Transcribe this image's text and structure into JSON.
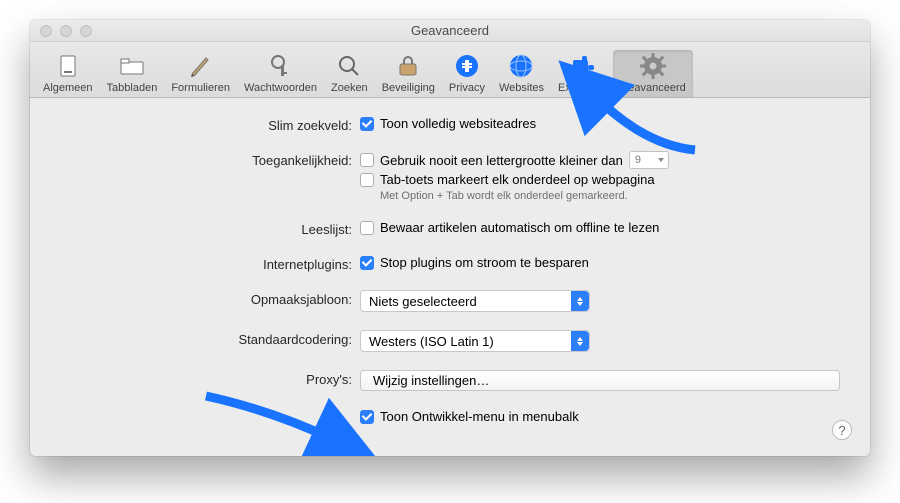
{
  "window": {
    "title": "Geavanceerd"
  },
  "toolbar": {
    "items": [
      {
        "id": "algemeen",
        "label": "Algemeen"
      },
      {
        "id": "tabbladen",
        "label": "Tabbladen"
      },
      {
        "id": "formulieren",
        "label": "Formulieren"
      },
      {
        "id": "wachtwoorden",
        "label": "Wachtwoorden"
      },
      {
        "id": "zoeken",
        "label": "Zoeken"
      },
      {
        "id": "beveiliging",
        "label": "Beveiliging"
      },
      {
        "id": "privacy",
        "label": "Privacy"
      },
      {
        "id": "websites",
        "label": "Websites"
      },
      {
        "id": "extensies",
        "label": "Extensies"
      },
      {
        "id": "geavanceerd",
        "label": "Geavanceerd"
      }
    ],
    "active": "geavanceerd"
  },
  "labels": {
    "smart_search": "Slim zoekveld:",
    "accessibility": "Toegankelijkheid:",
    "reading_list": "Leeslijst:",
    "internet_plugins": "Internetplugins:",
    "stylesheet": "Opmaaksjabloon:",
    "encoding": "Standaardcodering:",
    "proxies": "Proxy's:"
  },
  "fields": {
    "show_full_address": {
      "checked": true,
      "label": "Toon volledig websiteadres"
    },
    "never_smaller_font": {
      "checked": false,
      "label": "Gebruik nooit een lettergrootte kleiner dan",
      "size": "9"
    },
    "tab_highlights": {
      "checked": false,
      "label": "Tab-toets markeert elk onderdeel op webpagina",
      "hint": "Met Option + Tab wordt elk onderdeel gemarkeerd."
    },
    "save_articles": {
      "checked": false,
      "label": "Bewaar artikelen automatisch om offline te lezen"
    },
    "stop_plugins": {
      "checked": true,
      "label": "Stop plugins om stroom te besparen"
    },
    "stylesheet_value": "Niets geselecteerd",
    "encoding_value": "Westers (ISO Latin 1)",
    "proxies_button": "Wijzig instellingen…",
    "develop_menu": {
      "checked": true,
      "label": "Toon Ontwikkel-menu in menubalk"
    }
  },
  "help_tooltip": "?",
  "colors": {
    "accent": "#2b7ffb",
    "arrow": "#1a73ff"
  }
}
